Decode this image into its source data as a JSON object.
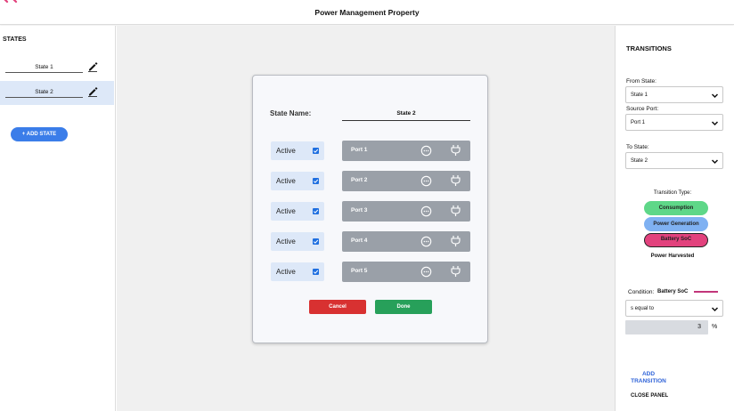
{
  "header": {
    "title": "Power Management Property"
  },
  "sidebar": {
    "title": "STATES",
    "states": [
      {
        "label": "State 1",
        "selected": false
      },
      {
        "label": "State 2",
        "selected": true
      }
    ],
    "add_state_label": "+ ADD STATE"
  },
  "dialog": {
    "state_name_label": "State Name:",
    "state_name_value": "State 2",
    "ports": [
      {
        "active_label": "Active",
        "checked": true,
        "port_label": "Port 1"
      },
      {
        "active_label": "Active",
        "checked": true,
        "port_label": "Port 2"
      },
      {
        "active_label": "Active",
        "checked": true,
        "port_label": "Port 3"
      },
      {
        "active_label": "Active",
        "checked": true,
        "port_label": "Port 4"
      },
      {
        "active_label": "Active",
        "checked": true,
        "port_label": "Port 5"
      }
    ],
    "cancel_label": "Cancel",
    "done_label": "Done"
  },
  "transitions": {
    "title": "TRANSITIONS",
    "from_state_label": "From State:",
    "from_state_value": "State 1",
    "source_port_label": "Source Port:",
    "source_port_value": "Port 1",
    "to_state_label": "To State:",
    "to_state_value": "State 2",
    "transition_type_label": "Transition Type:",
    "types": {
      "consumption": "Consumption",
      "power_generation": "Power Generation",
      "battery_soc": "Battery SoC",
      "power_harvested": "Power Harvested"
    },
    "condition_label": "Condition:",
    "condition_value": "Battery SoC",
    "operator_value": "s equal to",
    "threshold_value": "3",
    "unit": "%",
    "add_transition_label": "ADD TRANSITION",
    "close_panel_label": "CLOSE PANEL"
  },
  "colors": {
    "accent_blue": "#3b7de9",
    "selected_bg": "#dde8f8",
    "port_bg": "#9aa0a8",
    "cancel": "#d83131",
    "done": "#27a05a",
    "consumption": "#5ed788",
    "power_generation": "#7fb1f2",
    "battery_soc": "#e2427d"
  },
  "icons": [
    "logo-icon",
    "edit-pencil-icon",
    "checkbox-checked-icon",
    "dots-circle-icon",
    "plug-icon",
    "chevron-down-icon"
  ]
}
